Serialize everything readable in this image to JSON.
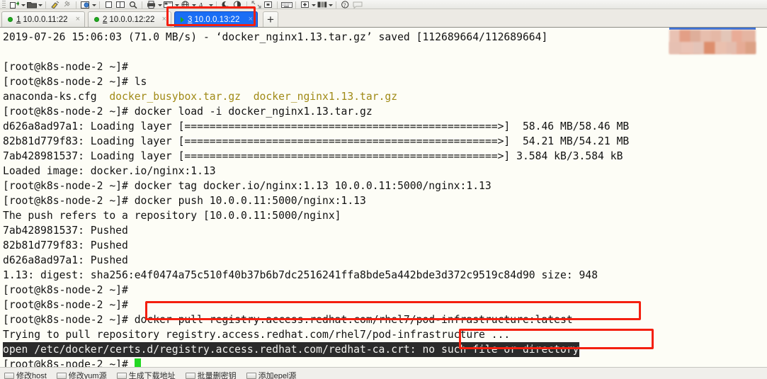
{
  "toolbar": {
    "icons": [
      "new-tab-icon",
      "new-tab-dropdown",
      "open-folder-icon",
      "open-folder-dropdown",
      "separator",
      "transfer-icon",
      "pin-icon",
      "separator",
      "settings-gear-icon",
      "settings-dropdown",
      "separator",
      "copy-icon",
      "paste-icon",
      "search-icon",
      "separator",
      "print-icon",
      "print-dropdown",
      "layout-icon",
      "layout-dropdown",
      "globe-icon",
      "globe-dropdown",
      "font-icon",
      "font-dropdown",
      "separator",
      "moon-icon",
      "contrast-icon",
      "separator",
      "fullscreen-icon",
      "screenshot-icon",
      "separator",
      "keyboard-icon",
      "separator",
      "zoom-in-icon",
      "zoom-in-dropdown",
      "split-view-icon",
      "split-view-dropdown",
      "separator",
      "help-icon",
      "comment-icon"
    ]
  },
  "tabs": [
    {
      "num": "1",
      "label": "10.0.0.11:22",
      "status": "connected",
      "active": false,
      "close": "×"
    },
    {
      "num": "2",
      "label": "10.0.0.12:22",
      "status": "connected",
      "active": false,
      "close": "×"
    },
    {
      "num": "3",
      "label": "10.0.0.13:22",
      "status": "connected",
      "active": true,
      "close": "×"
    }
  ],
  "new_tab_button": "+",
  "terminal": {
    "lines": [
      {
        "segments": [
          {
            "t": "2019-07-26 15:06:03 (71.0 MB/s) - ‘docker_nginx1.13.tar.gz’ saved [112689664/112689664]"
          }
        ]
      },
      {
        "segments": [
          {
            "t": ""
          }
        ]
      },
      {
        "segments": [
          {
            "t": "[root@k8s-node-2 ~]#"
          }
        ]
      },
      {
        "segments": [
          {
            "t": "[root@k8s-node-2 ~]# ls"
          }
        ]
      },
      {
        "segments": [
          {
            "t": "anaconda-ks.cfg  "
          },
          {
            "t": "docker_busybox.tar.gz  ",
            "c": "yellow"
          },
          {
            "t": "docker_nginx1.13.tar.gz",
            "c": "yellow"
          }
        ]
      },
      {
        "segments": [
          {
            "t": "[root@k8s-node-2 ~]# docker load -i docker_nginx1.13.tar.gz"
          }
        ]
      },
      {
        "segments": [
          {
            "t": "d626a8ad97a1: Loading layer [==================================================>]  58.46 MB/58.46 MB"
          }
        ]
      },
      {
        "segments": [
          {
            "t": "82b81d779f83: Loading layer [==================================================>]  54.21 MB/54.21 MB"
          }
        ]
      },
      {
        "segments": [
          {
            "t": "7ab428981537: Loading layer [==================================================>] 3.584 kB/3.584 kB"
          }
        ]
      },
      {
        "segments": [
          {
            "t": "Loaded image: docker.io/nginx:1.13"
          }
        ]
      },
      {
        "segments": [
          {
            "t": "[root@k8s-node-2 ~]# docker tag docker.io/nginx:1.13 10.0.0.11:5000/nginx:1.13"
          }
        ]
      },
      {
        "segments": [
          {
            "t": "[root@k8s-node-2 ~]# docker push 10.0.0.11:5000/nginx:1.13"
          }
        ]
      },
      {
        "segments": [
          {
            "t": "The push refers to a repository [10.0.0.11:5000/nginx]"
          }
        ]
      },
      {
        "segments": [
          {
            "t": "7ab428981537: Pushed"
          }
        ]
      },
      {
        "segments": [
          {
            "t": "82b81d779f83: Pushed"
          }
        ]
      },
      {
        "segments": [
          {
            "t": "d626a8ad97a1: Pushed"
          }
        ]
      },
      {
        "segments": [
          {
            "t": "1.13: digest: sha256:e4f0474a75c510f40b37b6b7dc2516241ffa8bde5a442bde3d372c9519c84d90 size: 948"
          }
        ]
      },
      {
        "segments": [
          {
            "t": "[root@k8s-node-2 ~]#"
          }
        ]
      },
      {
        "segments": [
          {
            "t": "[root@k8s-node-2 ~]#"
          }
        ]
      },
      {
        "segments": [
          {
            "t": "[root@k8s-node-2 ~]# docker pull registry.access.redhat.com/rhel7/pod-infrastructure:latest"
          }
        ]
      },
      {
        "segments": [
          {
            "t": "Trying to pull repository registry.access.redhat.com/rhel7/pod-infrastructure ..."
          }
        ]
      },
      {
        "segments": [
          {
            "t": "open /etc/docker/certs.d/registry.access.redhat.com/redhat-ca.crt: no such file or directory",
            "c": "inverse"
          }
        ]
      },
      {
        "segments": [
          {
            "t": "[root@k8s-node-2 ~]# "
          },
          {
            "t": "",
            "c": "cursor"
          }
        ]
      }
    ],
    "colors": {
      "background": "#fdfdf6",
      "foreground": "#121212",
      "archive_file": "#a08a16",
      "selection_background": "#2b2b2b",
      "selection_foreground": "#f2f2ef",
      "cursor": "#22d822"
    }
  },
  "annotations": {
    "box_color": "#f41f0f",
    "boxes": [
      {
        "name": "active-tab-highlight",
        "target": "tab 3 10.0.0.13:22"
      },
      {
        "name": "docker-pull-command-highlight",
        "target": "docker pull registry.access.redhat.com/rhel7/pod-infrastructure:latest"
      },
      {
        "name": "error-message-highlight",
        "target": "no such file or directory"
      }
    ]
  },
  "statusbar": {
    "items": [
      {
        "label": "修改host"
      },
      {
        "label": "修改yum源"
      },
      {
        "label": "生成下载地址"
      },
      {
        "label": "批量删密钥"
      },
      {
        "label": "添加epel源"
      }
    ]
  }
}
